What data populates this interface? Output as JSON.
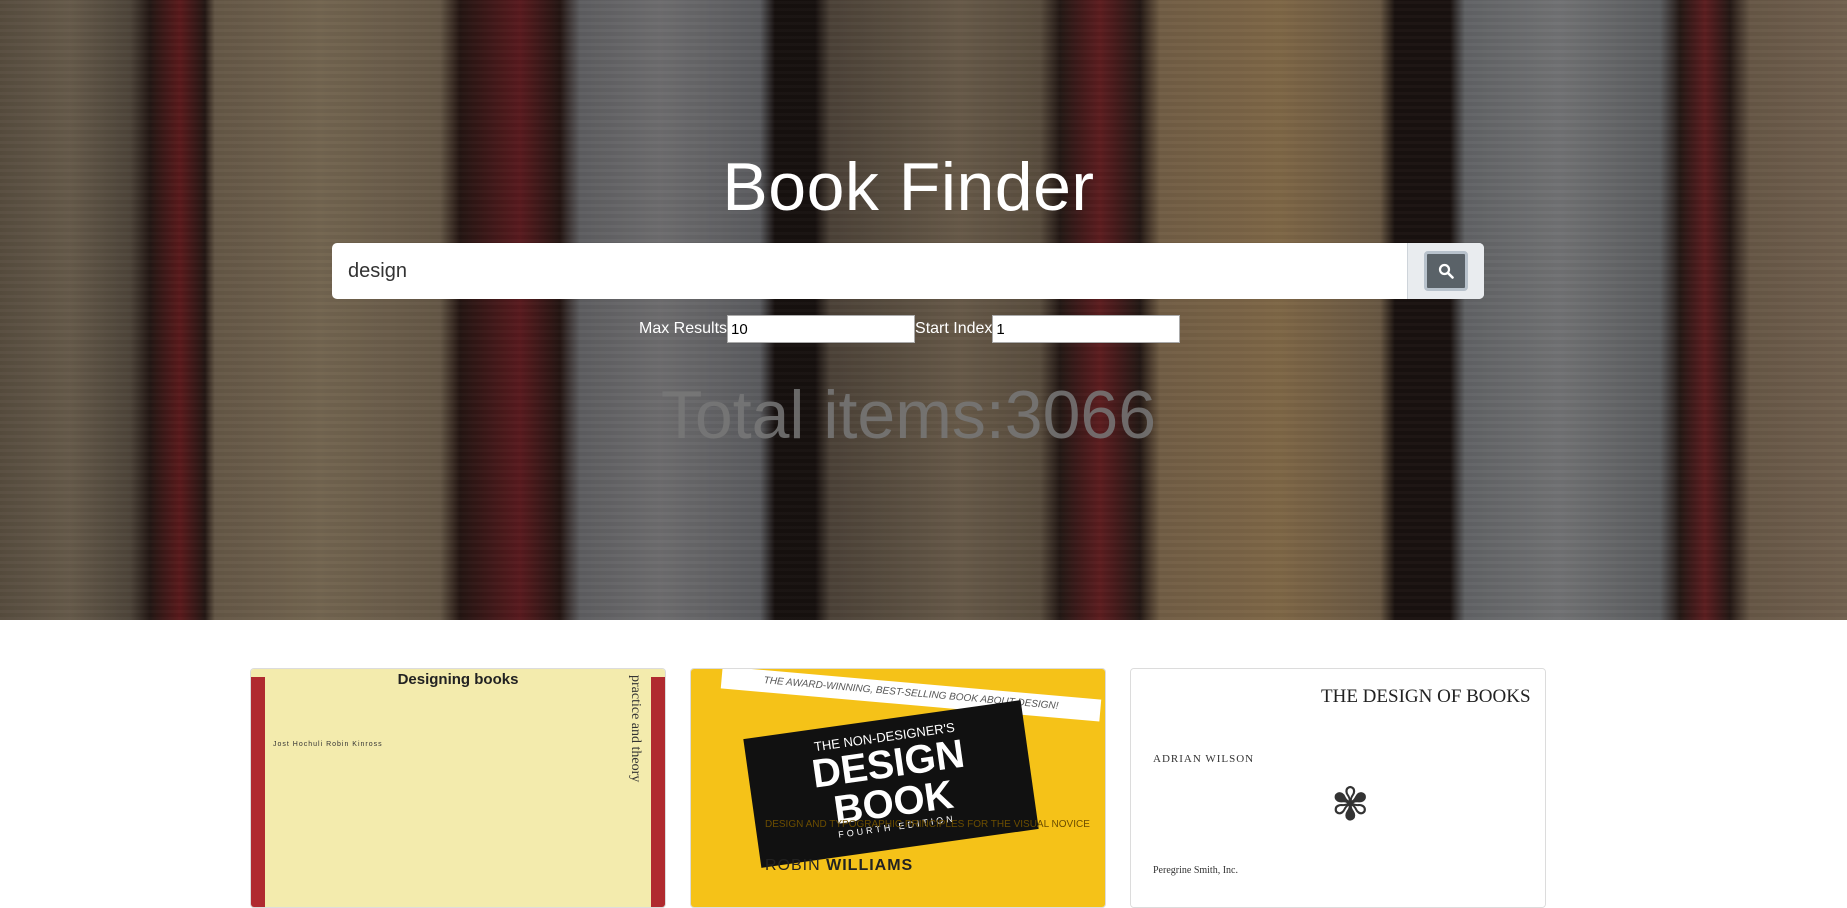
{
  "hero": {
    "title": "Book Finder",
    "search": {
      "value": "design",
      "button_icon": "search-icon"
    },
    "options": {
      "max_results_label": "Max Results",
      "max_results_value": "10",
      "start_index_label": "Start Index",
      "start_index_value": "1"
    },
    "total_label": "Total items:3066"
  },
  "cards": [
    {
      "cover_title": "Designing books",
      "cover_subtitle": "practice and theory",
      "cover_author": "Jost Hochuli  Robin Kinross"
    },
    {
      "cover_tagline": "THE AWARD-WINNING, BEST-SELLING BOOK ABOUT DESIGN!",
      "cover_series": "THE NON-DESIGNER'S",
      "cover_title_1": "DESIGN",
      "cover_title_2": "BOOK",
      "cover_edition": "FOURTH EDITION",
      "cover_subtitle": "DESIGN AND TYPOGRAPHIC PRINCIPLES FOR THE VISUAL NOVICE",
      "cover_author_first": "ROBIN",
      "cover_author_last": "WILLIAMS"
    },
    {
      "cover_title": "THE DESIGN OF BOOKS",
      "cover_author": "ADRIAN WILSON",
      "cover_publisher": "Peregrine Smith, Inc."
    }
  ]
}
